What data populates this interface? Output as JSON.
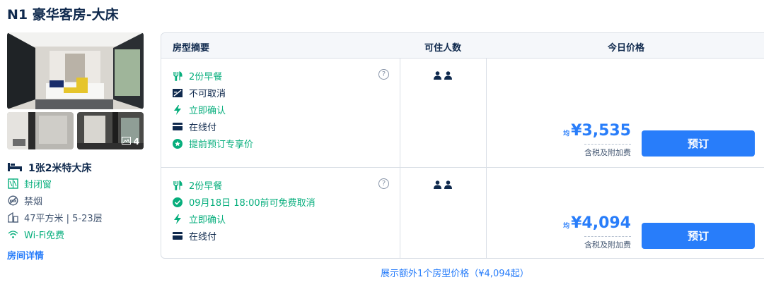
{
  "room": {
    "title": "N1 豪华客房-大床",
    "photo_count": "4",
    "bed": "1张2米特大床",
    "amenities": [
      {
        "label": "封闭窗",
        "icon": "window-icon",
        "green": true
      },
      {
        "label": "禁烟",
        "icon": "no-smoking-icon",
        "green": false
      },
      {
        "label": "47平方米 | 5-23层",
        "icon": "floor-area-icon",
        "green": false
      },
      {
        "label": "Wi-Fi免费",
        "icon": "wifi-icon",
        "green": true
      }
    ],
    "detail_link": "房间详情"
  },
  "table": {
    "headers": {
      "summary": "房型摘要",
      "guests": "可住人数",
      "price": "今日价格"
    },
    "rows": [
      {
        "features": [
          {
            "label": "2份早餐",
            "icon": "breakfast-icon",
            "green": true
          },
          {
            "label": "不可取消",
            "icon": "no-cancel-icon",
            "green": false
          },
          {
            "label": "立即确认",
            "icon": "lightning-icon",
            "green": true
          },
          {
            "label": "在线付",
            "icon": "card-icon",
            "green": false
          },
          {
            "label": "提前预订专享价",
            "icon": "star-badge-icon",
            "green": true
          }
        ],
        "avg_label": "均",
        "price": "¥3,535",
        "tax_note": "含税及附加费",
        "book_label": "预订"
      },
      {
        "features": [
          {
            "label": "2份早餐",
            "icon": "breakfast-icon",
            "green": true
          },
          {
            "label": "09月18日 18:00前可免费取消",
            "icon": "check-circle-icon",
            "green": true
          },
          {
            "label": "立即确认",
            "icon": "lightning-icon",
            "green": true
          },
          {
            "label": "在线付",
            "icon": "card-icon",
            "green": false
          }
        ],
        "avg_label": "均",
        "price": "¥4,094",
        "tax_note": "含税及附加费",
        "book_label": "预订"
      }
    ]
  },
  "footer": {
    "more_link": "展示额外1个房型价格（¥4,094起）"
  },
  "colors": {
    "accent": "#287dfa",
    "green": "#06ae7c",
    "text": "#0f294d"
  }
}
